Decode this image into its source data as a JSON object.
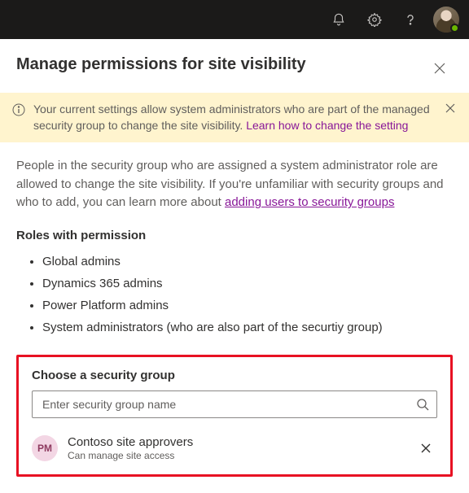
{
  "topbar": {
    "icons": [
      "notifications-icon",
      "settings-icon",
      "help-icon",
      "avatar"
    ]
  },
  "panel": {
    "title": "Manage permissions for site visibility"
  },
  "banner": {
    "text_prefix": "Your current settings allow system administrators who are part of the managed security group to change the site visibility. ",
    "link_text": "Learn how to change the setting"
  },
  "description": {
    "text_prefix": "People in the security group who are assigned a system administrator role are allowed to change the site visibility. If you're unfamiliar with security groups and who to add, you can learn more about ",
    "link_text": "adding users to security groups"
  },
  "roles": {
    "heading": "Roles with permission",
    "items": [
      "Global admins",
      "Dynamics 365 admins",
      "Power Platform admins",
      "System administrators (who are also part of the securtiy group)"
    ]
  },
  "search": {
    "heading": "Choose a security group",
    "placeholder": "Enter security group name"
  },
  "group": {
    "initials": "PM",
    "name": "Contoso site approvers",
    "description": "Can manage site access"
  }
}
